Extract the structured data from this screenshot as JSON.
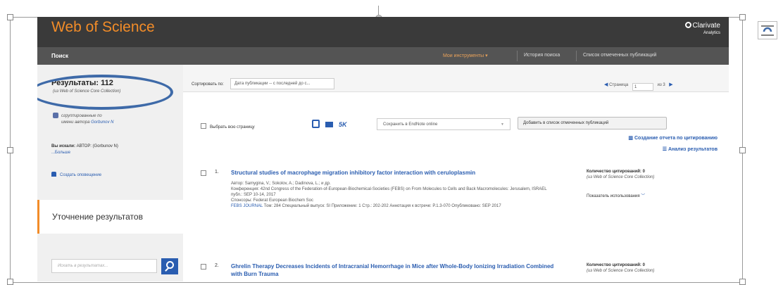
{
  "header": {
    "logo": "Web of Science",
    "brand": "Clarivate",
    "brand_sub": "Analytics"
  },
  "nav": {
    "search": "Поиск",
    "tools": "Мои инструменты ▾",
    "history": "История поиска",
    "marked": "Список отмеченных публикаций"
  },
  "sidebar": {
    "results_title": "Результаты: 112",
    "results_sub": "(из Web of Science Core Collection)",
    "author_group_line1": "сгруппированные по",
    "author_group_line2": "имени автора",
    "author_name": "Gorbunov N",
    "searched_label": "Вы искали:",
    "searched_value": "АВТОР: (Gorbunov N)",
    "more": "...Больше",
    "create_alert": "Создать оповещение",
    "refine_title": "Уточнение результатов",
    "refine_placeholder": "Искать в результатах..."
  },
  "sort": {
    "label": "Сортировать по:",
    "value": "Дата публикации -- с последней до с...",
    "page_label": "Страница",
    "page_value": "1",
    "page_of": "из 3"
  },
  "toolbar": {
    "select_page": "Выбрать всю страницу",
    "sk": "5K",
    "endnote": "Сохранить в EndNote online",
    "add_marked": "Добавить в список отмеченных публикаций",
    "citation_report": "Создание отчета по цитированию",
    "analyze": "Анализ результатов"
  },
  "records": [
    {
      "num": "1.",
      "title": "Structural studies of macrophage migration inhibitory factor interaction with ceruloplasmin",
      "authors": "Автор: Samygina, V.; Sokolov, A.; Dadinova, L.; и др.",
      "conference": "Конференция: 42nd Congress of the Federation-of-European-Biochemical-Societies (FEBS) on From Molecules to Cells and Back Macromolecules: Jerusalem, ISRAEL публ.: SEP 10-14, 2017",
      "sponsors": "Спонсоры: Federat European Biochem Soc",
      "journal": "FEBS JOURNAL",
      "source_tail": "Том: 284  Специальный выпуск: SI  Приложение: 1  Стр.: 202-202  Аннотация к встрече: P.1.3-070  Опубликовано: SEP 2017",
      "cites_label": "Количество цитирований: 0",
      "cites_sub": "(из Web of Science Core Collection)",
      "usage": "Показатель использования"
    },
    {
      "num": "2.",
      "title": "Ghrelin Therapy Decreases Incidents of Intracranial Hemorrhage in Mice after Whole-Body Ionizing Irradiation Combined with Burn Trauma",
      "cites_label": "Количество цитирований: 0",
      "cites_sub": "(из Web of Science Core Collection)"
    }
  ],
  "colors": {
    "accent_orange": "#f28c28",
    "link_blue": "#2a5db0",
    "highlight_ellipse": "#3e6aa8"
  }
}
